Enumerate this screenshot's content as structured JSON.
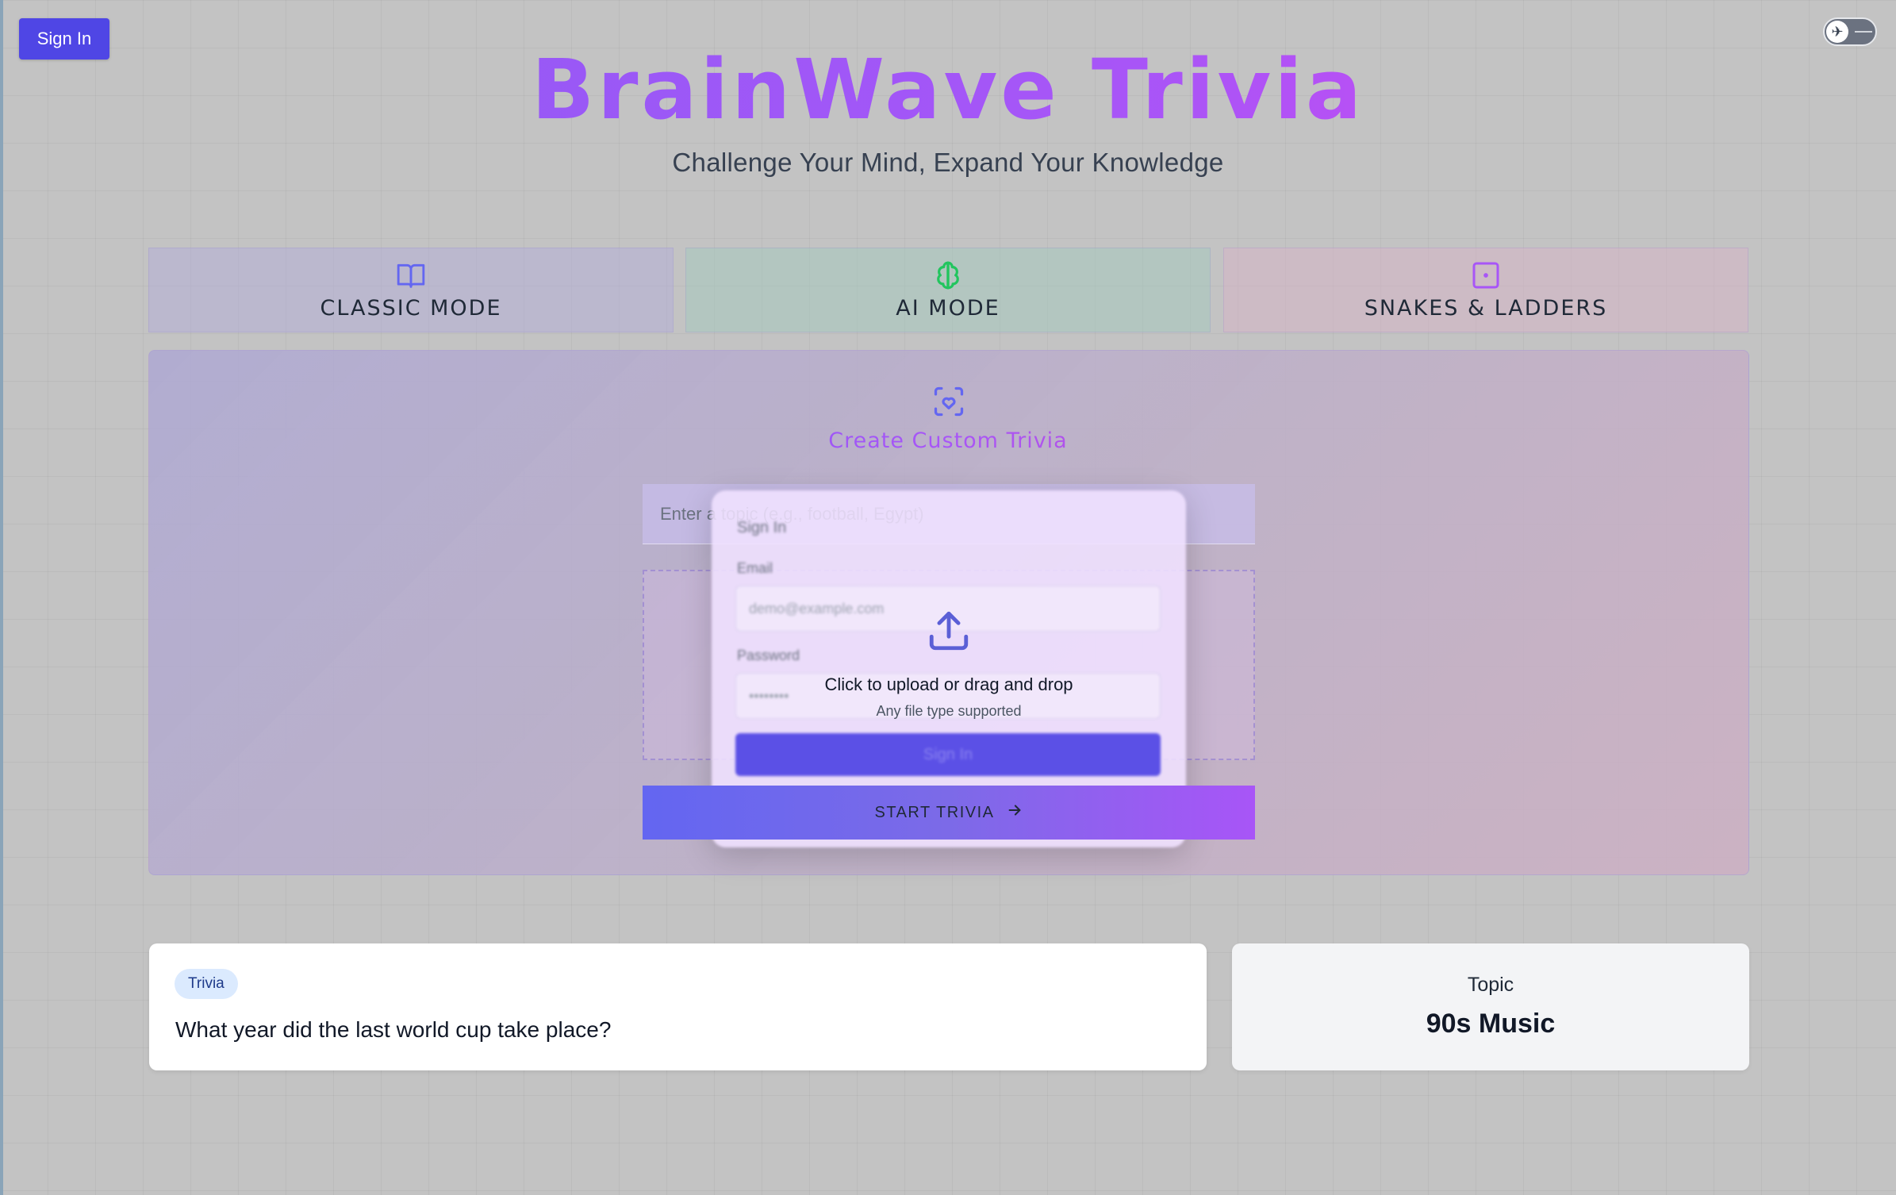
{
  "header": {
    "signin_label": "Sign In",
    "title": "BrainWave Trivia",
    "subtitle": "Challenge Your Mind, Expand Your Knowledge",
    "theme_toggle_icon": "airplane-icon"
  },
  "modes": [
    {
      "label": "CLASSIC MODE",
      "icon": "book-open-icon",
      "color": "#6366f1"
    },
    {
      "label": "AI MODE",
      "icon": "brain-icon",
      "color": "#22c55e"
    },
    {
      "label": "SNAKES & LADDERS",
      "icon": "dice-icon",
      "color": "#a855f7"
    }
  ],
  "custom": {
    "icon": "scan-heart-icon",
    "title": "Create Custom Trivia",
    "topic_placeholder": "Enter a topic (e.g., football, Egypt)",
    "upload_icon": "upload-icon",
    "upload_main": "Click to upload or drag and drop",
    "upload_sub": "Any file type supported",
    "start_label": "START TRIVIA",
    "start_icon": "arrow-right-icon"
  },
  "modal": {
    "title": "Sign In",
    "email_label": "Email",
    "email_placeholder": "demo@example.com",
    "password_label": "Password",
    "password_placeholder": "••••••••",
    "submit_label": "Sign In"
  },
  "question_card": {
    "badge": "Trivia",
    "question": "What year did the last world cup take place?"
  },
  "topic_card": {
    "label": "Topic",
    "value": "90s Music"
  },
  "colors": {
    "accent": "#4f46e5",
    "gradient_start": "#6366f1",
    "gradient_end": "#a855f7",
    "background": "#c3c3c3"
  }
}
